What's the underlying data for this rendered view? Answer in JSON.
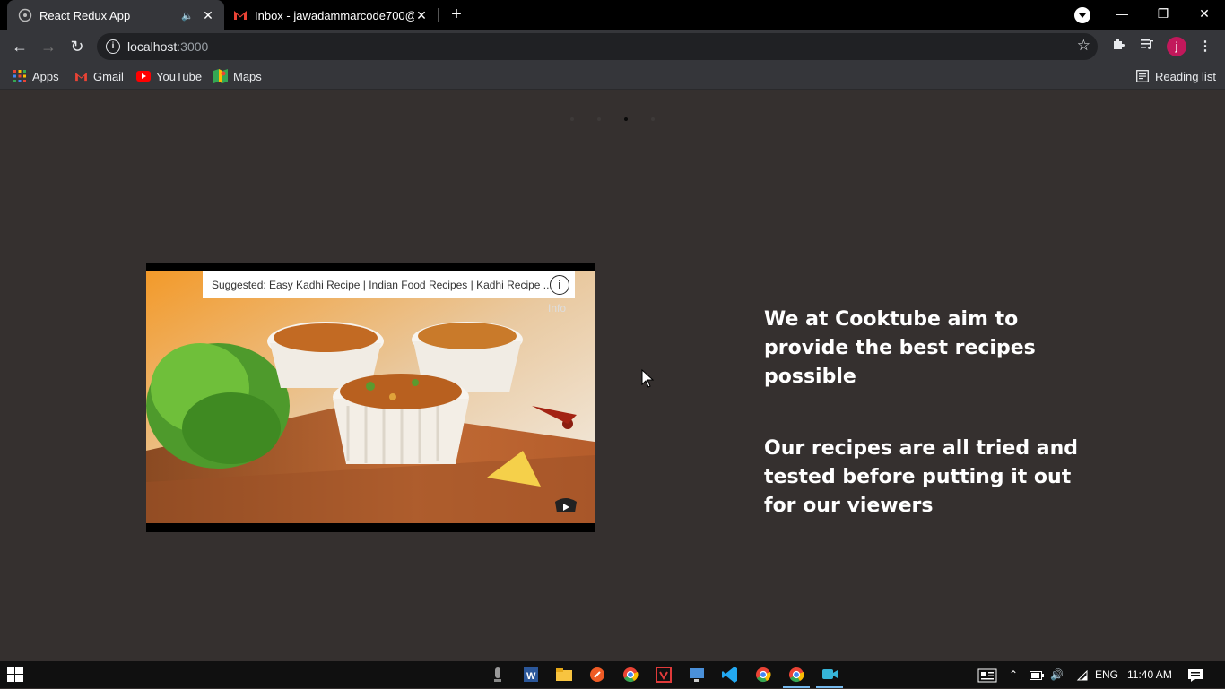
{
  "browser": {
    "tabs": [
      {
        "title": "React Redux App",
        "active": true,
        "favicon": "react-app-icon",
        "audio": true
      },
      {
        "title": "Inbox - jawadammarcode700@g",
        "active": false,
        "favicon": "gmail-icon"
      }
    ],
    "new_tab": "+",
    "url_host": "localhost",
    "url_port": ":3000",
    "avatar_letter": "j",
    "bookmarks": [
      {
        "label": "Apps",
        "icon": "apps-grid-icon"
      },
      {
        "label": "Gmail",
        "icon": "gmail-icon"
      },
      {
        "label": "YouTube",
        "icon": "youtube-icon"
      },
      {
        "label": "Maps",
        "icon": "maps-icon"
      }
    ],
    "reading_list": "Reading list"
  },
  "page": {
    "carousel_active_index": 2,
    "carousel_count": 4,
    "video": {
      "suggested": "Suggested: Easy Kadhi Recipe | Indian Food Recipes | Kadhi Recipe ...",
      "info_label": "Info"
    },
    "copy": [
      "We at Cooktube aim to provide the best recipes possible",
      "Our recipes are all tried and tested before putting it out for our viewers"
    ]
  },
  "taskbar": {
    "language": "ENG",
    "time": "11:40 AM"
  },
  "colors": {
    "page_bg": "#35302f",
    "chrome_bg": "#35363a",
    "tabstrip_bg": "#000000",
    "accent_avatar": "#c2185b"
  }
}
